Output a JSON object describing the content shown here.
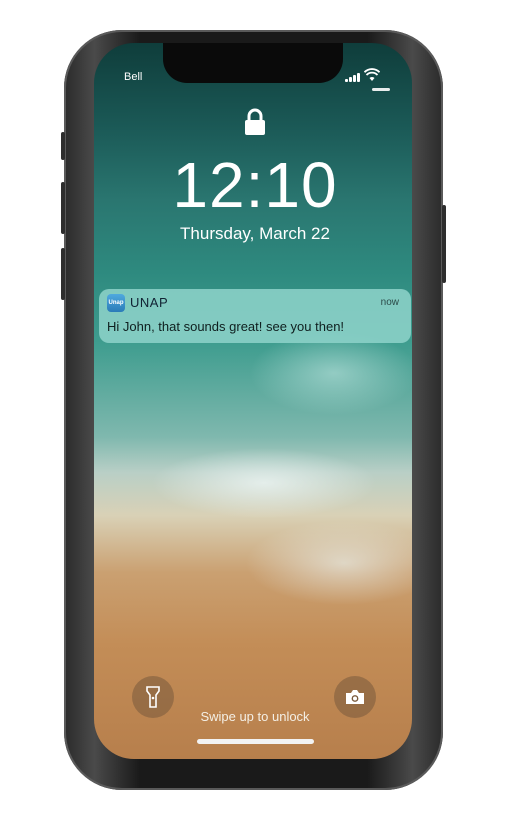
{
  "status_bar": {
    "carrier": "Bell"
  },
  "lock_screen": {
    "time": "12:10",
    "date": "Thursday, March 22"
  },
  "notification": {
    "app_icon_text": "Unap",
    "app_name": "UNAP",
    "time": "now",
    "message": "Hi John, that sounds great! see you then!"
  },
  "bottom": {
    "unlock_hint": "Swipe up to unlock",
    "left_icon": "flashlight-icon",
    "right_icon": "camera-icon"
  },
  "colors": {
    "notification_bg": "#8cd2c8",
    "frame": "#1a1a1a"
  }
}
